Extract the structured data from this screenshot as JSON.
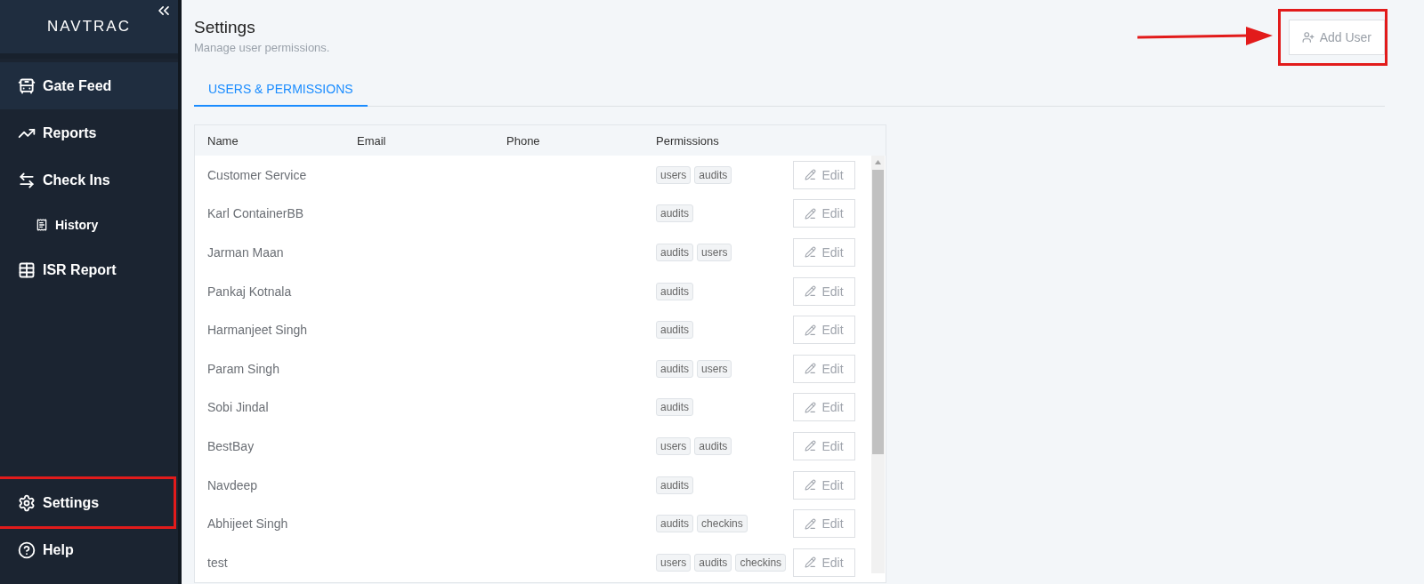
{
  "sidebar": {
    "logo": "NAVTRAC",
    "items": [
      {
        "kind": "gate",
        "label": "Gate Feed",
        "selected": true,
        "annotated": false
      },
      {
        "kind": "reports",
        "label": "Reports",
        "selected": false,
        "annotated": false
      },
      {
        "kind": "checkins",
        "label": "Check Ins",
        "selected": false,
        "annotated": false,
        "children": [
          {
            "kind": "history",
            "label": "History",
            "selected": false,
            "annotated": false
          }
        ]
      },
      {
        "kind": "isr",
        "label": "ISR Report",
        "selected": false,
        "annotated": false
      }
    ],
    "bottom_items": [
      {
        "kind": "settings",
        "label": "Settings",
        "selected": false,
        "annotated": true
      },
      {
        "kind": "help",
        "label": "Help",
        "selected": false,
        "annotated": false
      }
    ]
  },
  "header": {
    "title": "Settings",
    "subtitle": "Manage user permissions."
  },
  "add_user": {
    "label": "Add User",
    "annotated": true,
    "arrow": true
  },
  "tabs": [
    {
      "label": "USERS & PERMISSIONS",
      "selected": true
    }
  ],
  "table": {
    "columns": [
      "Name",
      "Email",
      "Phone",
      "Permissions"
    ],
    "rows": [
      {
        "name": "Customer Service",
        "permissions": [
          "users",
          "audits"
        ],
        "action": "Edit"
      },
      {
        "name": "Karl ContainerBB",
        "permissions": [
          "audits"
        ],
        "action": "Edit"
      },
      {
        "name": "Jarman Maan",
        "permissions": [
          "audits",
          "users"
        ],
        "action": "Edit"
      },
      {
        "name": "Pankaj Kotnala",
        "permissions": [
          "audits"
        ],
        "action": "Edit"
      },
      {
        "name": "Harmanjeet Singh",
        "permissions": [
          "audits"
        ],
        "action": "Edit"
      },
      {
        "name": "Param Singh",
        "permissions": [
          "audits",
          "users"
        ],
        "action": "Edit"
      },
      {
        "name": "Sobi Jindal",
        "permissions": [
          "audits"
        ],
        "action": "Edit"
      },
      {
        "name": "BestBay",
        "permissions": [
          "users",
          "audits"
        ],
        "action": "Edit"
      },
      {
        "name": "Navdeep",
        "permissions": [
          "audits"
        ],
        "action": "Edit"
      },
      {
        "name": "Abhijeet Singh",
        "permissions": [
          "audits",
          "checkins"
        ],
        "action": "Edit"
      },
      {
        "name": "test",
        "permissions": [
          "users",
          "audits",
          "checkins"
        ],
        "action": "Edit"
      }
    ]
  }
}
